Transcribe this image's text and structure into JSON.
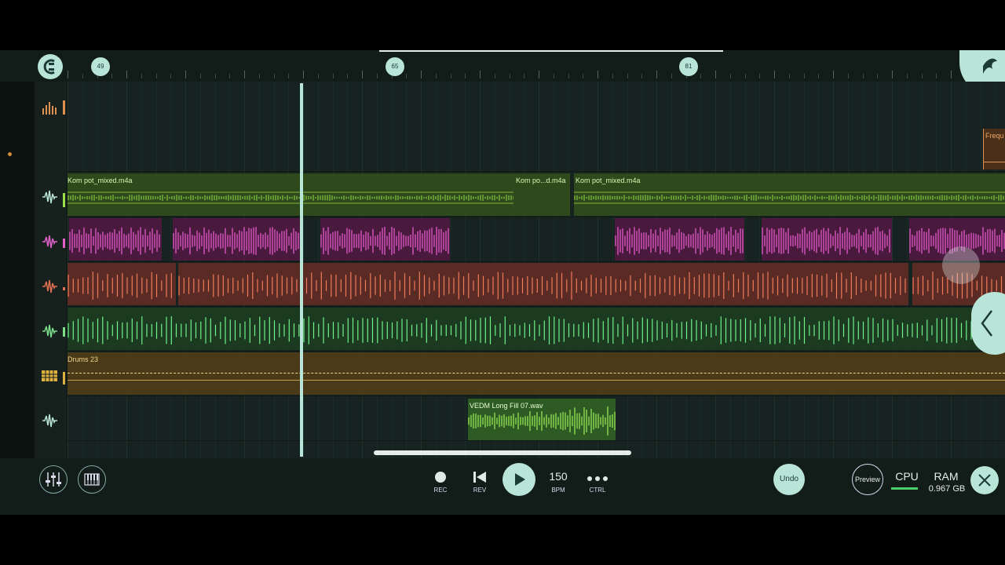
{
  "ruler": {
    "markers": [
      "49",
      "65",
      "81"
    ]
  },
  "clips": {
    "audio1_a": "Kom pot_mixed.m4a",
    "audio1_b": "Kom po...d.m4a",
    "audio1_c": "Kom pot_mixed.m4a",
    "pattern": "Drums 23",
    "fill": "VEDM Long Fill 07.wav",
    "freq": "Frequ"
  },
  "transport": {
    "rec": "REC",
    "rev": "REV",
    "tempo": "150",
    "bpm": "BPM",
    "ctrl": "CTRL"
  },
  "buttons": {
    "undo": "Undo",
    "preview": "Preview"
  },
  "status": {
    "cpu": "CPU",
    "ram": "RAM",
    "ram_value": "0.967 GB"
  },
  "colors": {
    "accent": "#b9e4d8",
    "green_clip": "#2e4a1c",
    "pink_clip": "#4a1a3e",
    "red_clip": "#5a2a24",
    "green_track": "#1c3a20",
    "drums_clip": "#4a3a18"
  }
}
